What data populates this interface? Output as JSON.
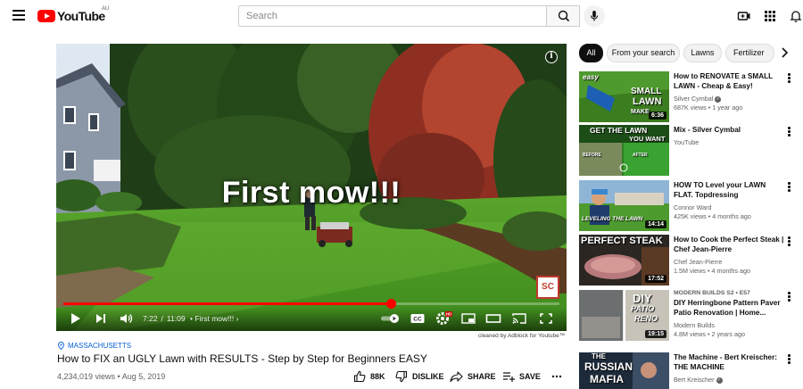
{
  "header": {
    "logo_text": "YouTube",
    "region": "AU",
    "search_placeholder": "Search"
  },
  "player": {
    "overlay_text": "First mow!!!",
    "current_time": "7:22",
    "separator": "/",
    "duration": "11:09",
    "chapter": "• First mow!!! ›",
    "progress_fraction": 0.66,
    "watermark_text": "SC",
    "hd_badge": "HD",
    "cleaned_note": "cleaned by Adblock for Youtube™"
  },
  "video": {
    "location": "MASSACHUSETTS",
    "title": "How to FIX an UGLY Lawn with RESULTS - Step by Step for Beginners EASY",
    "views_line": "4,234,019 views • Aug 5, 2019",
    "like_count": "88K",
    "dislike_label": "DISLIKE",
    "share_label": "SHARE",
    "save_label": "SAVE"
  },
  "chips": [
    "All",
    "From your search",
    "Lawns",
    "Fertilizer"
  ],
  "recommendations": [
    {
      "title": "How to RENOVATE a SMALL LAWN - Cheap & Easy!",
      "channel": "Silver Cymbal",
      "verified": true,
      "meta": "687K views • 1 year ago",
      "duration": "6:36",
      "thumb_text_1": "SMALL",
      "thumb_text_2": "LAWN",
      "thumb_text_3": "MAKE",
      "thumb_text_4": "easy"
    },
    {
      "title": "Mix - Silver Cymbal",
      "channel": "YouTube",
      "verified": false,
      "meta": "",
      "duration": "",
      "thumb_text_1": "GET THE LAWN",
      "thumb_text_2": "YOU WANT",
      "thumb_text_3": "BEFORE",
      "thumb_text_4": "AFTER"
    },
    {
      "title": "HOW TO Level your LAWN FLAT. Topdressing",
      "channel": "Connor Ward",
      "verified": false,
      "meta": "425K views • 4 months ago",
      "duration": "14:14",
      "thumb_text_1": "LEVELING THE LAWN"
    },
    {
      "title": "How to Cook the Perfect Steak | Chef Jean-Pierre",
      "channel": "Chef Jean-Pierre",
      "verified": false,
      "meta": "1.5M views • 4 months ago",
      "duration": "17:52",
      "thumb_text_1": "PERFECT STEAK"
    },
    {
      "label": "MODERN BUILDS  S2 • E57",
      "title": "DIY Herringbone Pattern Paver Patio Renovation | Home...",
      "channel": "Modern Builds",
      "verified": false,
      "meta": "4.8M views • 2 years ago",
      "duration": "19:15",
      "thumb_text_1": "DIY",
      "thumb_text_2": "PATIO",
      "thumb_text_3": "RENO"
    },
    {
      "title": "The Machine - Bert Kreischer: THE MACHINE",
      "channel": "Bert Kreischer",
      "verified": true,
      "meta": "",
      "duration": "",
      "thumb_text_1": "THE",
      "thumb_text_2": "RUSSIAN",
      "thumb_text_3": "MAFIA"
    }
  ],
  "colors": {
    "brand_red": "#ff0000",
    "link_blue": "#065fd4",
    "chip_active": "#0f0f0f"
  }
}
